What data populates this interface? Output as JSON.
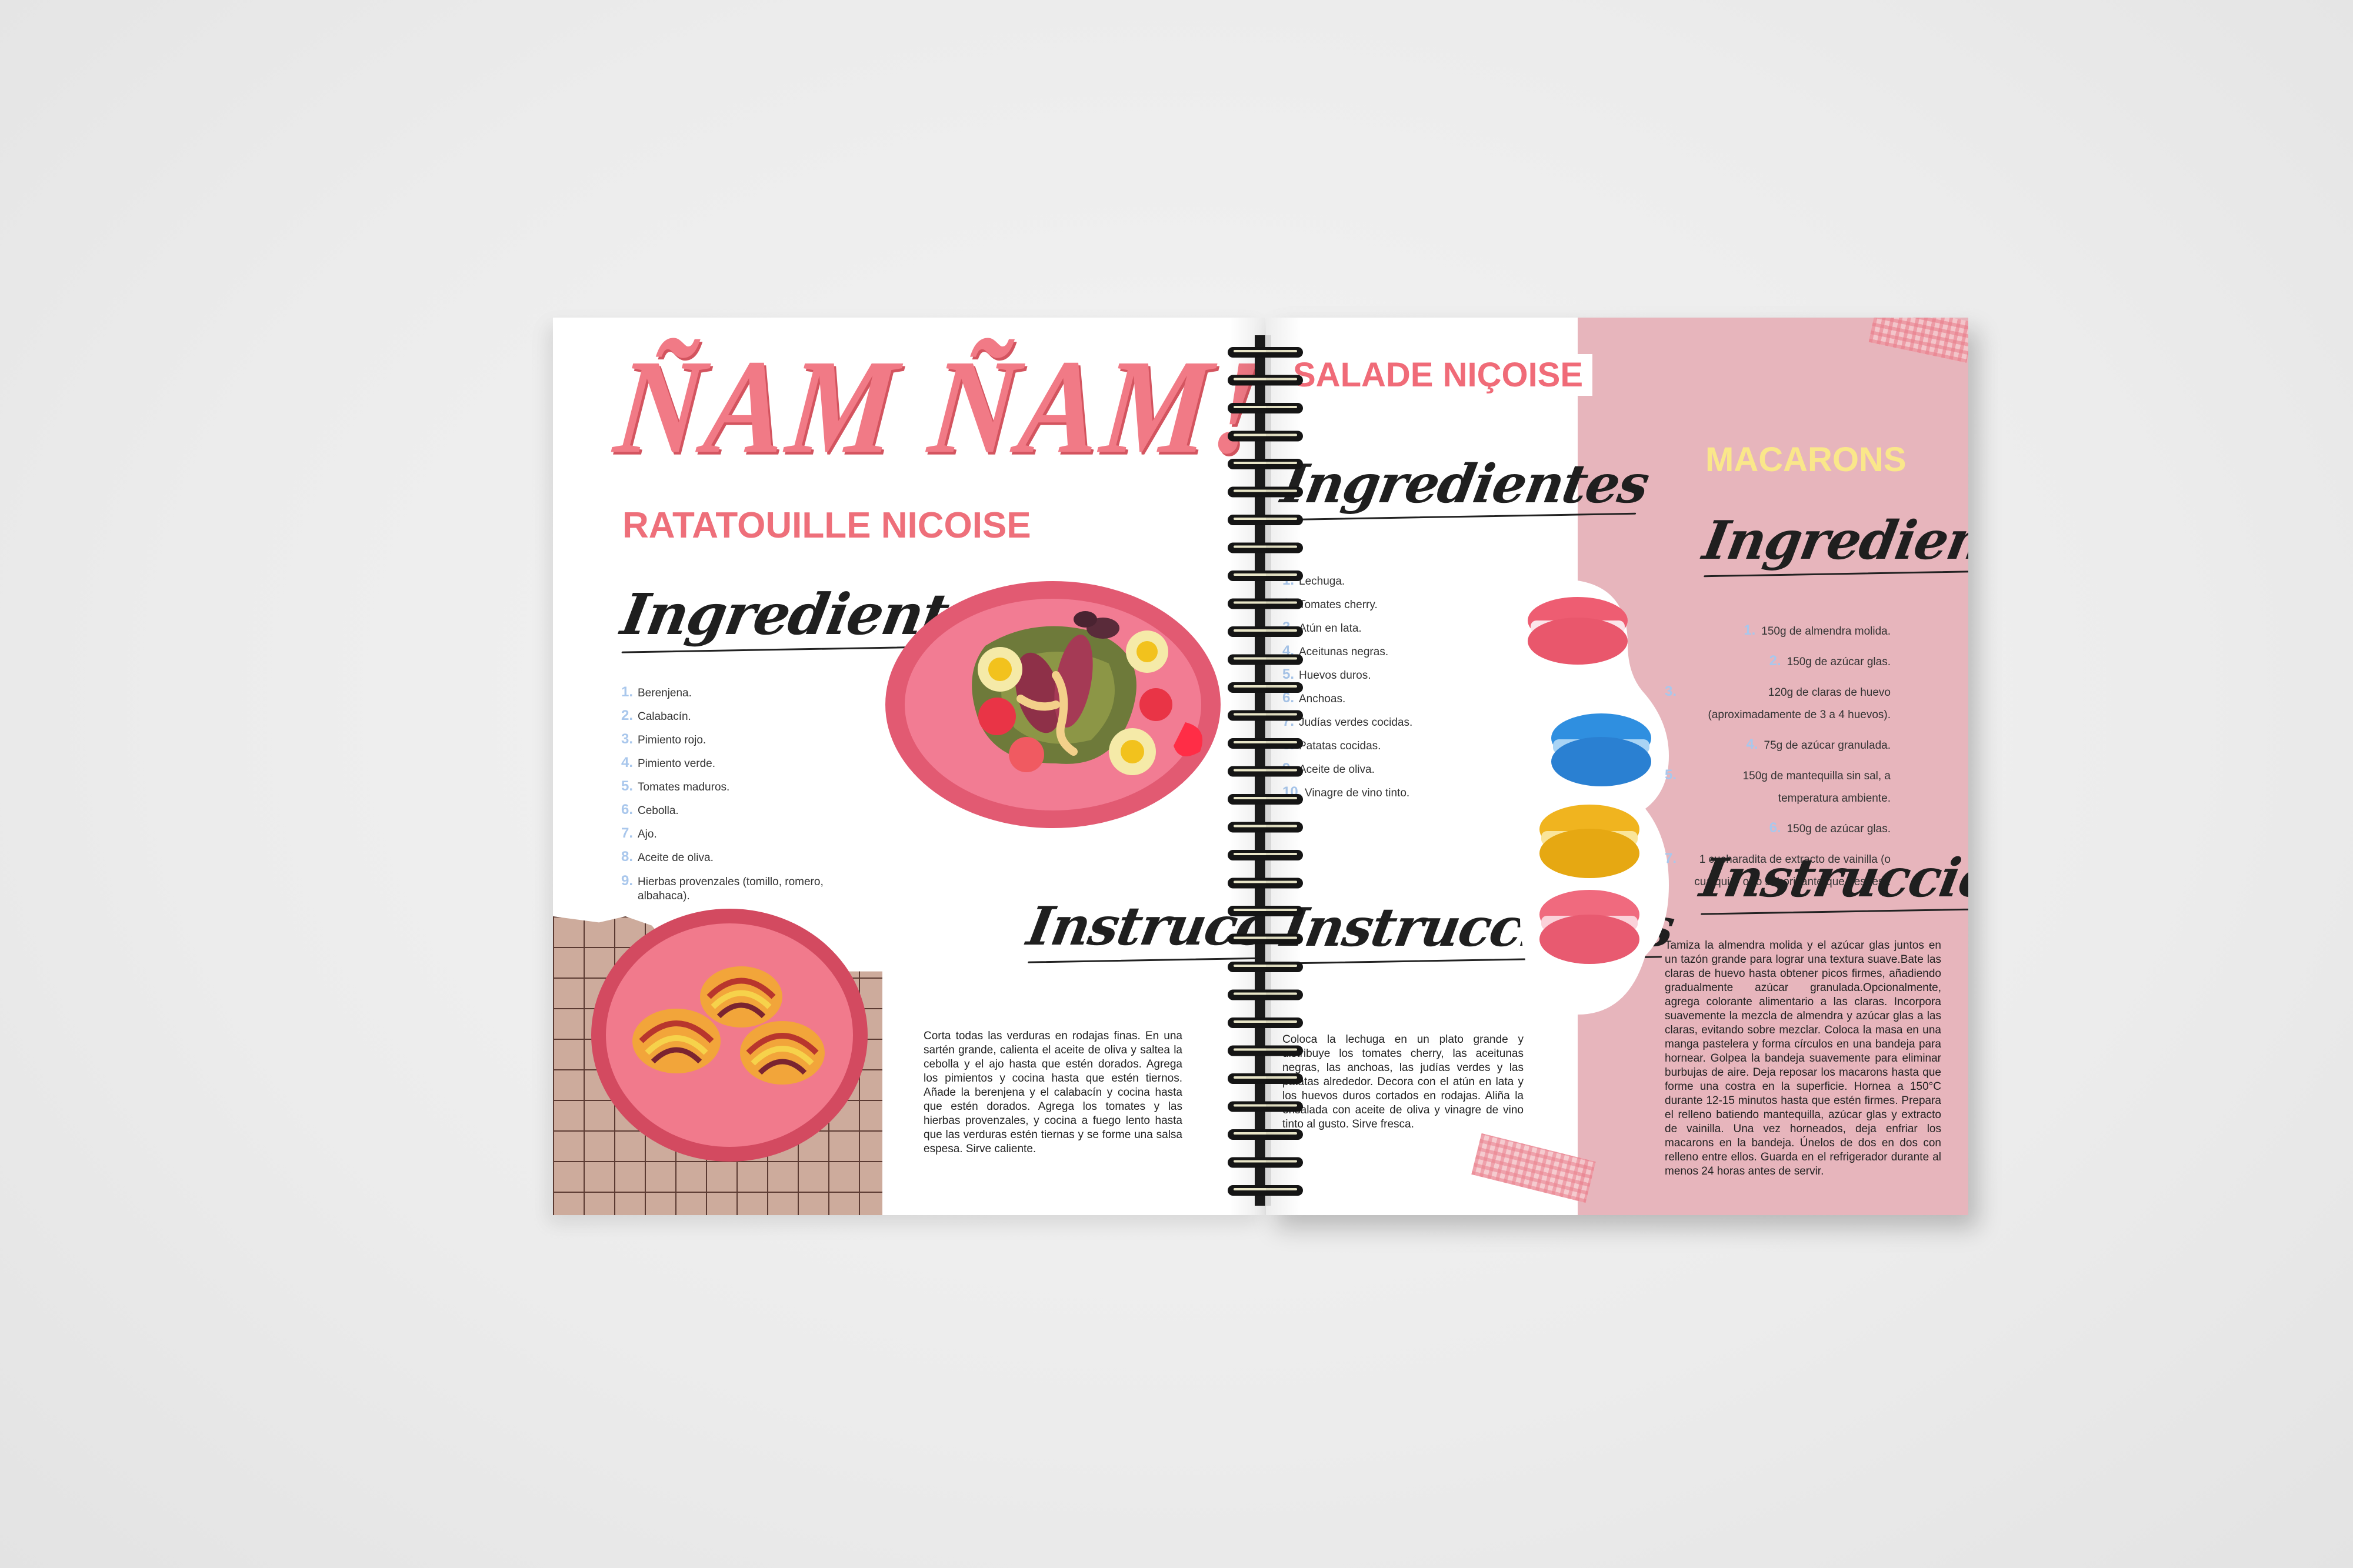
{
  "left_page": {
    "title": "ÑAM ÑAM!!",
    "recipe": {
      "title": "RATATOUILLE NICOISE",
      "ingredients_heading": "Ingredientes",
      "ingredients": [
        {
          "num": "1.",
          "text": "Berenjena."
        },
        {
          "num": "2.",
          "text": "Calabacín."
        },
        {
          "num": "3.",
          "text": "Pimiento rojo."
        },
        {
          "num": "4.",
          "text": "Pimiento verde."
        },
        {
          "num": "5.",
          "text": "Tomates maduros."
        },
        {
          "num": "6.",
          "text": "Cebolla."
        },
        {
          "num": "7.",
          "text": "Ajo."
        },
        {
          "num": "8.",
          "text": "Aceite de oliva."
        },
        {
          "num": "9.",
          "text": "Hierbas provenzales (tomillo, romero, albahaca)."
        }
      ],
      "instructions_heading": "Instrucciones",
      "instructions": "Corta todas las verduras en rodajas finas. En una sartén grande, calienta el aceite de oliva y saltea la cebolla y el ajo hasta que estén dorados. Agrega los pimientos y cocina hasta que estén tiernos. Añade la berenjena y el calabacín y cocina hasta que estén dorados. Agrega los tomates y las hierbas provenzales, y cocina a fuego lento hasta que las verduras estén tiernas y se forme una salsa espesa. Sirve caliente."
    }
  },
  "right_page": {
    "salade": {
      "title": "SALADE NIÇOISE",
      "ingredients_heading": "Ingredientes",
      "ingredients": [
        {
          "num": "1.",
          "text": "Lechuga."
        },
        {
          "num": "2.",
          "text": "Tomates cherry."
        },
        {
          "num": "3.",
          "text": "Atún en lata."
        },
        {
          "num": "4.",
          "text": "Aceitunas negras."
        },
        {
          "num": "5.",
          "text": "Huevos duros."
        },
        {
          "num": "6.",
          "text": "Anchoas."
        },
        {
          "num": "7.",
          "text": "Judías verdes cocidas."
        },
        {
          "num": "8.",
          "text": "Patatas cocidas."
        },
        {
          "num": "9.",
          "text": "Aceite de oliva."
        },
        {
          "num": "10.",
          "text": "Vinagre de vino tinto."
        }
      ],
      "instructions_heading": "Instrucciones",
      "instructions": "Coloca la lechuga en un plato grande y distribuye los tomates cherry, las aceitunas negras, las anchoas, las judías verdes y las patatas alrededor. Decora con el atún en lata y los huevos duros cortados en rodajas. Aliña la ensalada con aceite de oliva y vinagre de vino tinto al gusto. Sirve fresca."
    },
    "macarons": {
      "title": "MACARONS",
      "ingredients_heading": "Ingredientes",
      "ingredients": [
        {
          "num": "1.",
          "text": "150g de almendra molida."
        },
        {
          "num": "2.",
          "text": "150g de azúcar glas."
        },
        {
          "num": "3.",
          "text": "120g de claras de huevo (aproximadamente de 3 a 4 huevos)."
        },
        {
          "num": "4.",
          "text": "75g de azúcar granulada."
        },
        {
          "num": "5.",
          "text": "150g de mantequilla sin sal, a temperatura ambiente."
        },
        {
          "num": "6.",
          "text": "150g de azúcar glas."
        },
        {
          "num": "7.",
          "text": "1 cucharadita de extracto de vainilla (o cualquier otro saborizante que desees)."
        }
      ],
      "instructions_heading": "Instrucciones",
      "instructions": "Tamiza la almendra molida y el azúcar glas juntos en un tazón grande para lograr una textura suave.Bate las claras de huevo hasta obtener picos firmes, añadiendo gradualmente azúcar granulada.Opcionalmente, agrega colorante alimentario a las claras. Incorpora suavemente la mezcla de almendra y azúcar glas a las claras, evitando sobre mezclar. Coloca la masa en una manga pastelera y forma círculos en una bandeja para hornear. Golpea la bandeja suavemente para eliminar burbujas de aire. Deja reposar los macarons hasta que forme una costra en la superficie. Hornea a 150°C durante 12-15 minutos hasta que estén firmes. Prepara el relleno batiendo mantequilla, azúcar glas y extracto de vainilla. Una vez horneados, deja enfriar los macarons en la bandeja. Únelos de dos en dos con relleno entre ellos. Guarda en el refrigerador durante al menos 24 horas antes de servir."
    }
  },
  "illustrations": {
    "salad_plate": "salad-plate-illustration",
    "ratatouille_plate": "ratatouille-plate-illustration",
    "macarons_stack": "macarons-illustration",
    "binding": "spiral-binding"
  },
  "colors": {
    "title_pink": "#f17a86",
    "rose_panel": "#e7b5bc",
    "macarons_yellow": "#fae78a",
    "list_number_blue": "#a9c7ec",
    "grid_tan": "#cdab9c"
  }
}
